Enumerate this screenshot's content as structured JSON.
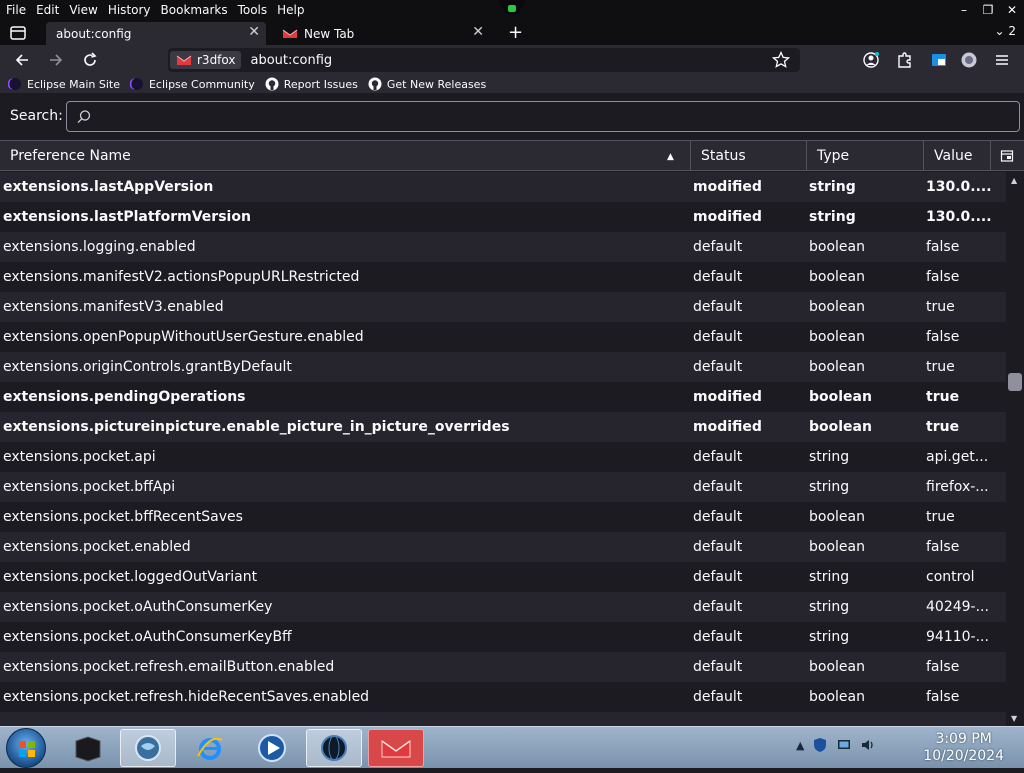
{
  "menubar": {
    "items": [
      "File",
      "Edit",
      "View",
      "History",
      "Bookmarks",
      "Tools",
      "Help"
    ],
    "window_controls": [
      "–",
      "❐",
      "✕"
    ]
  },
  "tabs": [
    {
      "label": "about:config",
      "active": true
    },
    {
      "label": "New Tab",
      "active": false
    }
  ],
  "tab_overflow": "2",
  "navbar": {
    "identity_label": "r3dfox",
    "url": "about:config"
  },
  "bookmarks": [
    {
      "label": "Eclipse Main Site",
      "icon": "eclipse-icon"
    },
    {
      "label": "Eclipse Community",
      "icon": "eclipse-icon"
    },
    {
      "label": "Report Issues",
      "icon": "github-icon"
    },
    {
      "label": "Get New Releases",
      "icon": "github-icon"
    }
  ],
  "config": {
    "search_label": "Search:",
    "search_placeholder": "",
    "columns": {
      "name": "Preference Name",
      "status": "Status",
      "type": "Type",
      "value": "Value"
    },
    "rows": [
      {
        "name": "extensions.lastAppVersion",
        "status": "modified",
        "type": "string",
        "value": "130.0...."
      },
      {
        "name": "extensions.lastPlatformVersion",
        "status": "modified",
        "type": "string",
        "value": "130.0...."
      },
      {
        "name": "extensions.logging.enabled",
        "status": "default",
        "type": "boolean",
        "value": "false"
      },
      {
        "name": "extensions.manifestV2.actionsPopupURLRestricted",
        "status": "default",
        "type": "boolean",
        "value": "false"
      },
      {
        "name": "extensions.manifestV3.enabled",
        "status": "default",
        "type": "boolean",
        "value": "true"
      },
      {
        "name": "extensions.openPopupWithoutUserGesture.enabled",
        "status": "default",
        "type": "boolean",
        "value": "false"
      },
      {
        "name": "extensions.originControls.grantByDefault",
        "status": "default",
        "type": "boolean",
        "value": "true"
      },
      {
        "name": "extensions.pendingOperations",
        "status": "modified",
        "type": "boolean",
        "value": "true"
      },
      {
        "name": "extensions.pictureinpicture.enable_picture_in_picture_overrides",
        "status": "modified",
        "type": "boolean",
        "value": "true"
      },
      {
        "name": "extensions.pocket.api",
        "status": "default",
        "type": "string",
        "value": "api.get..."
      },
      {
        "name": "extensions.pocket.bffApi",
        "status": "default",
        "type": "string",
        "value": "firefox-..."
      },
      {
        "name": "extensions.pocket.bffRecentSaves",
        "status": "default",
        "type": "boolean",
        "value": "true"
      },
      {
        "name": "extensions.pocket.enabled",
        "status": "default",
        "type": "boolean",
        "value": "false"
      },
      {
        "name": "extensions.pocket.loggedOutVariant",
        "status": "default",
        "type": "string",
        "value": "control"
      },
      {
        "name": "extensions.pocket.oAuthConsumerKey",
        "status": "default",
        "type": "string",
        "value": "40249-..."
      },
      {
        "name": "extensions.pocket.oAuthConsumerKeyBff",
        "status": "default",
        "type": "string",
        "value": "94110-..."
      },
      {
        "name": "extensions.pocket.refresh.emailButton.enabled",
        "status": "default",
        "type": "boolean",
        "value": "false"
      },
      {
        "name": "extensions.pocket.refresh.hideRecentSaves.enabled",
        "status": "default",
        "type": "boolean",
        "value": "false"
      },
      {
        "name": "",
        "status": "",
        "type": "",
        "value": ""
      }
    ]
  },
  "taskbar": {
    "apps": [
      "terminal-app",
      "browser-app",
      "internet-explorer-app",
      "media-player-app",
      "globe-app",
      "r3dfox-app"
    ],
    "clock_time": "3:09 PM",
    "clock_date": "10/20/2024"
  },
  "colors": {
    "chrome_dark": "#0f0f12",
    "toolbar": "#2b2a33",
    "content": "#1c1b22",
    "text": "#fbfbfe",
    "accent_red": "#e0393e"
  }
}
